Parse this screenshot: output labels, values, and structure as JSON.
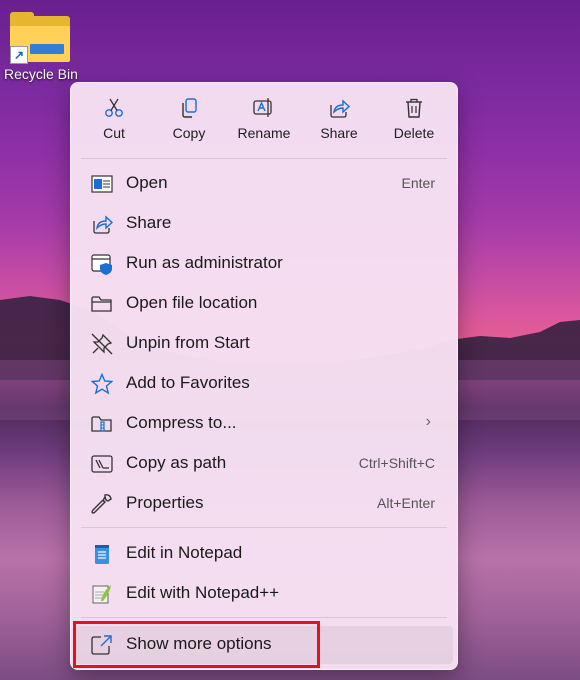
{
  "desktop": {
    "icon_label": "Recycle Bin"
  },
  "toolbar": {
    "cut": "Cut",
    "copy": "Copy",
    "rename": "Rename",
    "share": "Share",
    "delete": "Delete"
  },
  "menu": {
    "items": [
      {
        "label": "Open",
        "shortcut": "Enter"
      },
      {
        "label": "Share",
        "shortcut": ""
      },
      {
        "label": "Run as administrator",
        "shortcut": ""
      },
      {
        "label": "Open file location",
        "shortcut": ""
      },
      {
        "label": "Unpin from Start",
        "shortcut": ""
      },
      {
        "label": "Add to Favorites",
        "shortcut": ""
      },
      {
        "label": "Compress to...",
        "shortcut": ""
      },
      {
        "label": "Copy as path",
        "shortcut": "Ctrl+Shift+C"
      },
      {
        "label": "Properties",
        "shortcut": "Alt+Enter"
      },
      {
        "label": "Edit in Notepad",
        "shortcut": ""
      },
      {
        "label": "Edit with Notepad++",
        "shortcut": ""
      },
      {
        "label": "Show more options",
        "shortcut": ""
      }
    ],
    "submenu_chevron": "›"
  },
  "colors": {
    "highlight": "#e0141e",
    "accent": "#0067c0"
  }
}
